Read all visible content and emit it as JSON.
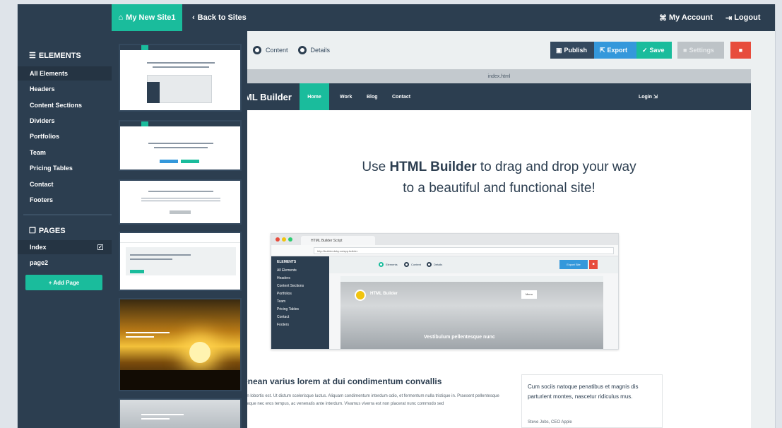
{
  "topbar": {
    "site_name": "My New Site1",
    "back_label": "Back to Sites",
    "account_label": "My Account",
    "logout_label": "Logout"
  },
  "sidebar": {
    "elements_title": "ELEMENTS",
    "items": [
      {
        "label": "All Elements"
      },
      {
        "label": "Headers"
      },
      {
        "label": "Content Sections"
      },
      {
        "label": "Dividers"
      },
      {
        "label": "Portfolios"
      },
      {
        "label": "Team"
      },
      {
        "label": "Pricing Tables"
      },
      {
        "label": "Contact"
      },
      {
        "label": "Footers"
      }
    ],
    "pages_title": "PAGES",
    "pages": [
      {
        "label": "Index"
      },
      {
        "label": "page2"
      }
    ],
    "add_page_label": "+ Add Page"
  },
  "modes": [
    {
      "label": "Content"
    },
    {
      "label": "Details"
    }
  ],
  "actions": {
    "publish": "Publish",
    "export": "Export",
    "save": "Save",
    "settings": "Settings"
  },
  "file_name": "index.html",
  "canvas": {
    "brand": "ML Builder",
    "nav": [
      "Home",
      "Work",
      "Blog",
      "Contact"
    ],
    "login": "Login",
    "hero_prefix": "Use ",
    "hero_bold": "HTML Builder",
    "hero_suffix": " to drag and drop your way",
    "hero_line2": "to a beautiful and functional site!",
    "mock": {
      "tab_title": "HTML Builder Script",
      "url": "http://builder.dsky.co/app.builder",
      "sidebar_title": "ELEMENTS",
      "sidebar_items": [
        "All Elements",
        "Headers",
        "Content Sections",
        "Portfolios",
        "Team",
        "Pricing Tables",
        "Contact",
        "Footers"
      ],
      "radio_labels": [
        "Elements",
        "Content",
        "Details"
      ],
      "export_label": "Export Site",
      "site_title": "HTML Builder",
      "menu_label": "Menu",
      "hero_text": "Vestibulum pellentesque nunc"
    },
    "section_title": "enean varius lorem at dui condimentum convallis",
    "section_text": "on lobortis est. Ut dictum scelerisque luctus. Aliquam condimentum interdum odio, et fermentum nulla tristique in. Praesent pellentesque neque nec eros tempus, ac venenatis ante interdum. Vivamus viverra est non placerat nunc commodo sed",
    "quote_text": "Cum sociis natoque penatibus et magnis dis parturient montes, nascetur ridiculus mus.",
    "quote_author": "Steve Jobs, CEO Apple"
  },
  "colors": {
    "dark": "#2c3e50",
    "accent": "#1abc9c",
    "blue": "#3498db",
    "danger": "#e74c3c"
  },
  "icons": [
    "home-icon",
    "chevron-left-icon",
    "account-icon",
    "logout-icon",
    "list-icon",
    "pages-icon",
    "publish-icon",
    "export-icon",
    "check-icon",
    "settings-icon",
    "trash-icon",
    "login-icon"
  ]
}
